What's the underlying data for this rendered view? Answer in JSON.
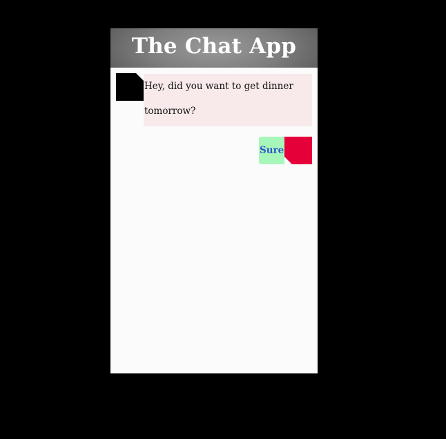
{
  "app": {
    "title": "The Chat App"
  },
  "messages": [
    {
      "side": "left",
      "text": "Hey, did you want to get dinner tomorrow?",
      "avatar_color": "#000000",
      "bubble_color": "#f8e9ea"
    },
    {
      "side": "right",
      "text": "Sure.",
      "avatar_color": "#e6003a",
      "bubble_color": "#a7f7bb",
      "text_color": "#2f57c9"
    }
  ],
  "colors": {
    "page_background": "#000000",
    "chat_background": "#fbfbfb",
    "header_gradient": "#7d7d7d"
  }
}
